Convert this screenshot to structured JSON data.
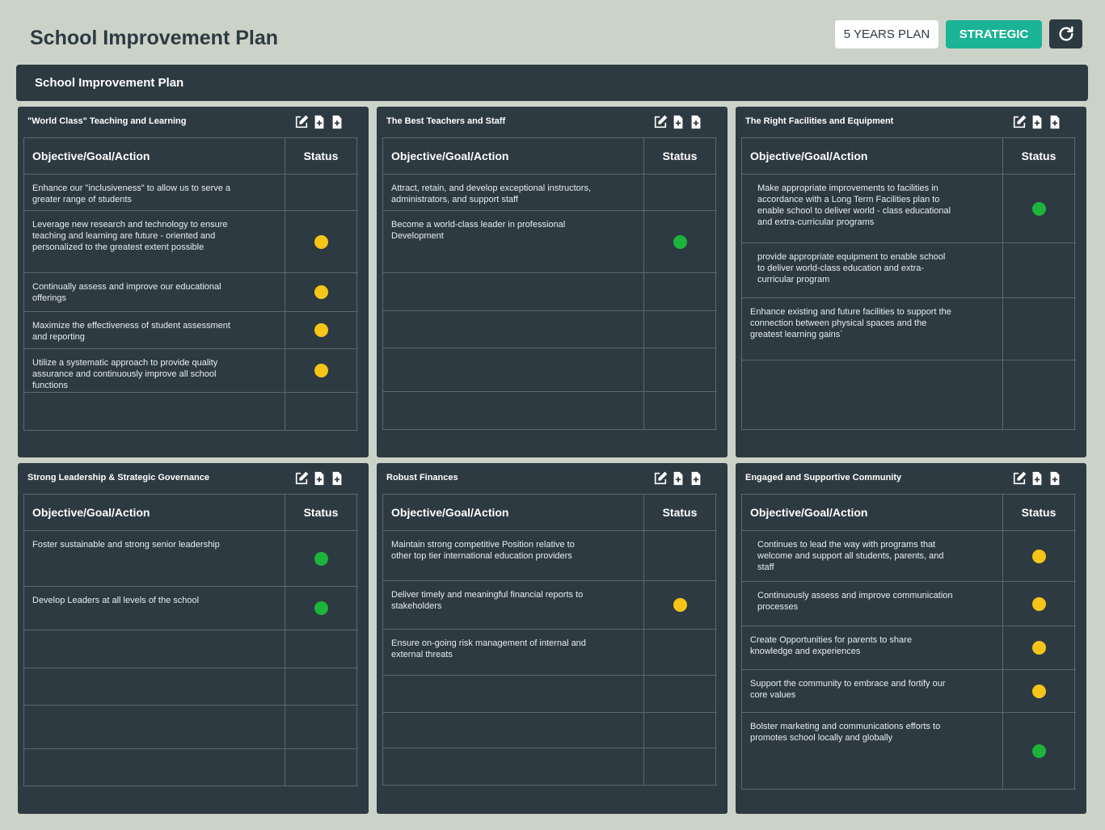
{
  "header": {
    "title": "School Improvement Plan",
    "plan_button": "5 YEARS PLAN",
    "strategic_button": "STRATEGIC"
  },
  "banner": {
    "title": "School Improvement Plan"
  },
  "colors": {
    "yellow": "#f5c518",
    "green": "#1db43c",
    "accent": "#1bb395",
    "panel": "#2d3a42"
  },
  "table_headers": {
    "objective": "Objective/Goal/Action",
    "status": "Status"
  },
  "panels": [
    {
      "title": "\"World Class\" Teaching and Learning",
      "rows": [
        {
          "text": "Enhance our \"inclusiveness\" to allow us to serve a greater range of students",
          "status": ""
        },
        {
          "text": "Leverage new research and technology to ensure teaching and learning are future - oriented  and personalized to the greatest extent possible",
          "status": "yellow"
        },
        {
          "text": "Continually assess and improve our educational offerings",
          "status": "yellow"
        },
        {
          "text": "Maximize the effectiveness of student assessment and reporting",
          "status": "yellow"
        },
        {
          "text": "Utilize a systematic approach to provide quality assurance and continuously improve all school functions",
          "status": "yellow"
        },
        {
          "text": "",
          "status": ""
        }
      ]
    },
    {
      "title": "The Best Teachers and Staff",
      "rows": [
        {
          "text": "Attract, retain, and develop exceptional instructors, administrators, and support staff",
          "status": ""
        },
        {
          "text": "Become a world-class leader in professional Development",
          "status": "green"
        },
        {
          "text": "",
          "status": ""
        },
        {
          "text": "",
          "status": ""
        },
        {
          "text": "",
          "status": ""
        },
        {
          "text": "",
          "status": ""
        }
      ]
    },
    {
      "title": "The Right Facilities and Equipment",
      "rows": [
        {
          "text": "Make appropriate improvements to facilities in accordance with a Long Term Facilities plan to enable school to deliver world - class educational and extra-curricular programs",
          "status": "green"
        },
        {
          "text": "provide appropriate equipment to enable school to deliver world-class education and extra-curricular program",
          "status": ""
        },
        {
          "text": "Enhance existing and future facilities to support the connection between physical spaces and the greatest learning gains`",
          "status": ""
        },
        {
          "text": "",
          "status": ""
        }
      ]
    },
    {
      "title": "Strong Leadership & Strategic Governance",
      "rows": [
        {
          "text": "Foster sustainable and strong senior leadership",
          "status": "green"
        },
        {
          "text": "Develop Leaders at all levels of the school",
          "status": "green"
        },
        {
          "text": "",
          "status": ""
        },
        {
          "text": "",
          "status": ""
        },
        {
          "text": "",
          "status": ""
        },
        {
          "text": "",
          "status": ""
        }
      ]
    },
    {
      "title": "Robust Finances",
      "rows": [
        {
          "text": "Maintain strong competitive Position relative to other top tier international education providers",
          "status": ""
        },
        {
          "text": "Deliver timely and meaningful financial reports to stakeholders",
          "status": "yellow"
        },
        {
          "text": "Ensure on-going risk management of internal and external threats",
          "status": ""
        },
        {
          "text": "",
          "status": ""
        },
        {
          "text": "",
          "status": ""
        },
        {
          "text": "",
          "status": ""
        }
      ]
    },
    {
      "title": "Engaged and Supportive Community",
      "rows": [
        {
          "text": "Continues to lead the way with programs that welcome and support all students, parents, and staff",
          "status": "yellow"
        },
        {
          "text": "Continuously assess and improve communication processes",
          "status": "yellow"
        },
        {
          "text": "Create Opportunities for parents to share knowledge and experiences",
          "status": "yellow"
        },
        {
          "text": "Support the community to embrace and fortify our core values",
          "status": "yellow"
        },
        {
          "text": "Bolster marketing and communications efforts to promotes school locally and globally",
          "status": "green"
        }
      ]
    }
  ]
}
